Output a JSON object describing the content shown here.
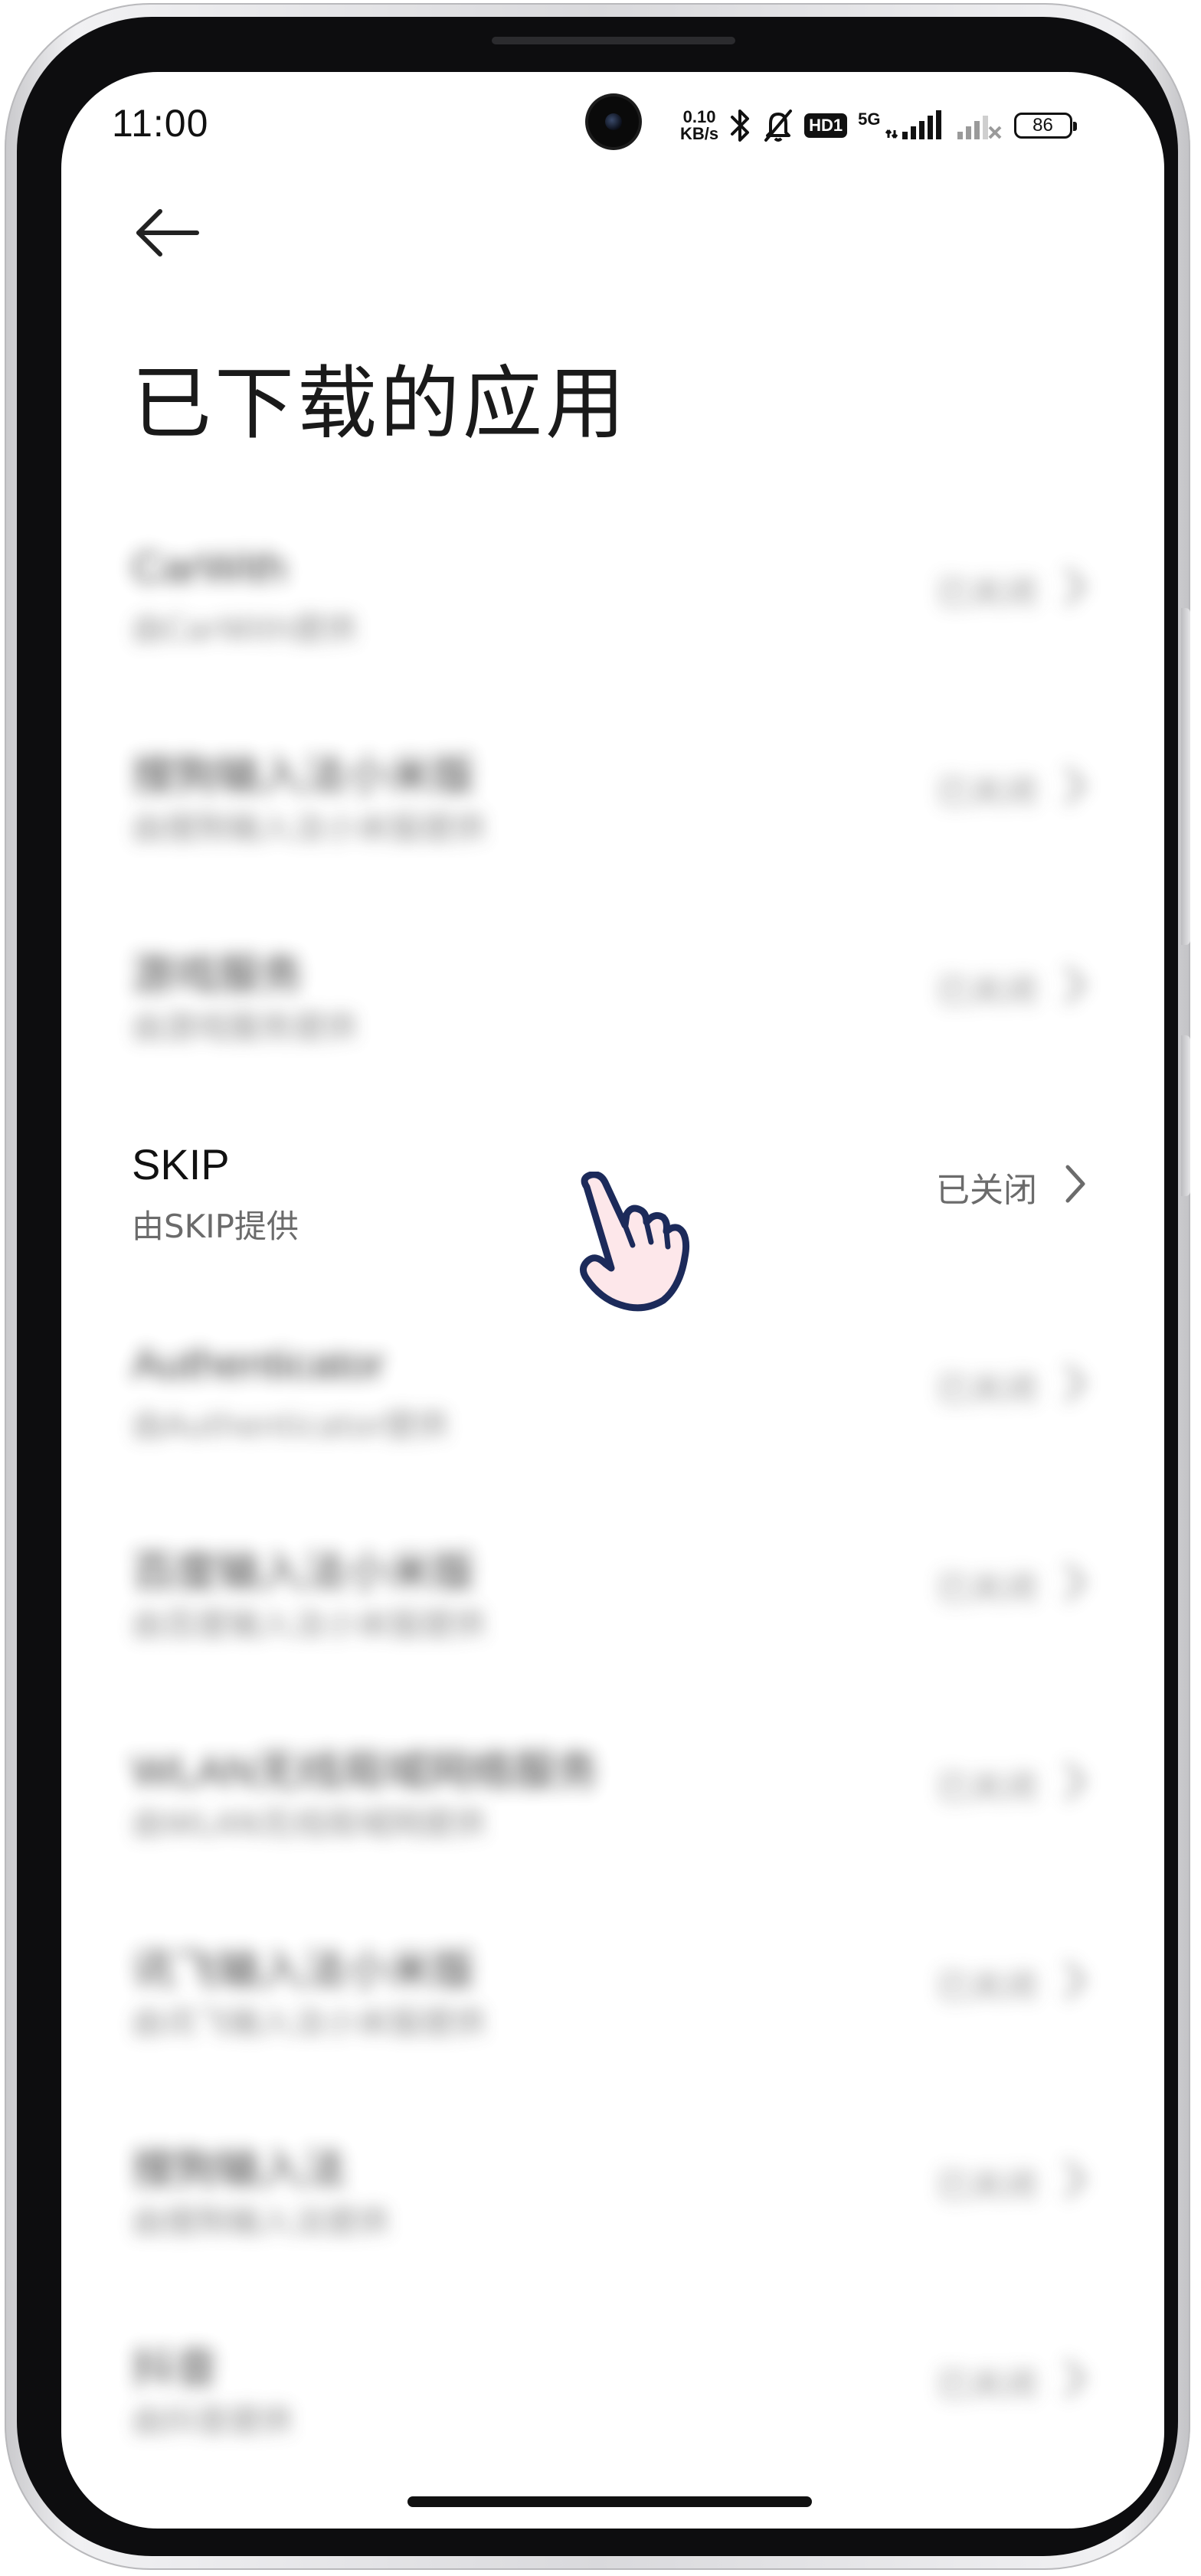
{
  "status_bar": {
    "time": "11:00",
    "speed_value": "0.10",
    "speed_unit": "KB/s",
    "hd_label": "HD1",
    "network_type": "5G",
    "battery": "86"
  },
  "header": {
    "back_icon": "arrow-left-icon",
    "title": "已下载的应用"
  },
  "apps": [
    {
      "name": "CarWith",
      "provider": "由CarWith提供",
      "status": "已关闭",
      "obscured": true
    },
    {
      "name": "搜狗输入法小米版",
      "provider": "由搜狗输入法小米版提供",
      "status": "已关闭",
      "obscured": true
    },
    {
      "name": "游戏服务",
      "provider": "由游戏服务提供",
      "status": "已关闭",
      "obscured": true
    },
    {
      "name": "SKIP",
      "provider": "由SKIP提供",
      "status": "已关闭",
      "obscured": false
    },
    {
      "name": "Authenticator",
      "provider": "由Authenticator提供",
      "status": "已关闭",
      "obscured": true
    },
    {
      "name": "百度输入法小米版",
      "provider": "由百度输入法小米版提供",
      "status": "已关闭",
      "obscured": true
    },
    {
      "name": "WLAN无线局域网络服务",
      "provider": "由WLAN无线局域网提供",
      "status": "已关闭",
      "obscured": true
    },
    {
      "name": "讯飞输入法小米版",
      "provider": "由讯飞输入法小米版提供",
      "status": "已关闭",
      "obscured": true
    },
    {
      "name": "搜狗输入法",
      "provider": "由搜狗输入法提供",
      "status": "已关闭",
      "obscured": true
    },
    {
      "name": "抖音",
      "provider": "由抖音提供",
      "status": "已关闭",
      "obscured": true
    }
  ],
  "chevron_icon": "chevron-right-icon",
  "tap_indicator_icon": "pointing-hand-icon"
}
